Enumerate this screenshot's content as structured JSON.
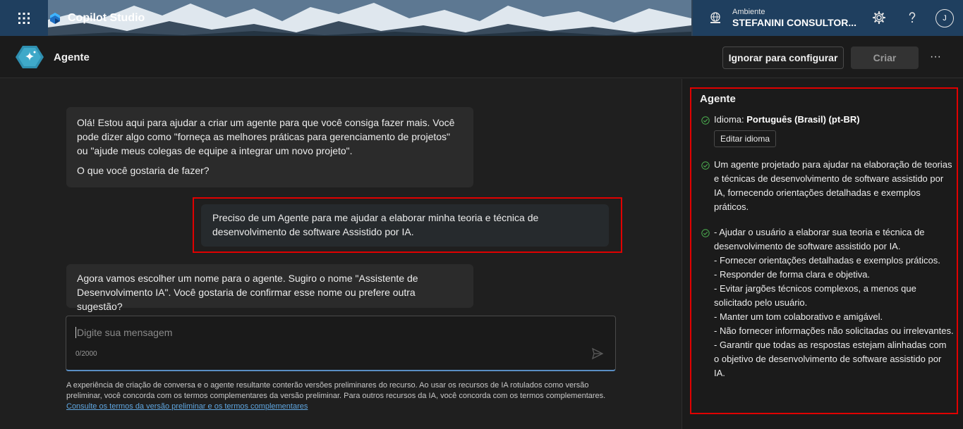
{
  "app": {
    "title": "Copilot Studio",
    "environment_label": "Ambiente",
    "environment_name": "STEFANINI CONSULTOR...",
    "user_initial": "J"
  },
  "header": {
    "title": "Agente",
    "skip_button": "Ignorar para configurar",
    "create_button": "Criar",
    "more_label": "···"
  },
  "chat": {
    "messages": [
      {
        "role": "assistant",
        "paragraphs": [
          "Olá! Estou aqui para ajudar a criar um agente para que você consiga fazer mais. Você pode dizer algo como \"forneça as melhores práticas para gerenciamento de projetos\" ou \"ajude meus colegas de equipe a integrar um novo projeto\".",
          "O que você gostaria de fazer?"
        ]
      },
      {
        "role": "user",
        "text": "Preciso de um Agente para me ajudar a elaborar minha teoria e técnica de desenvolvimento de software Assistido por IA."
      },
      {
        "role": "assistant",
        "text": "Agora vamos escolher um nome para o agente. Sugiro o nome \"Assistente de Desenvolvimento IA\". Você gostaria de confirmar esse nome ou prefere outra sugestão?"
      }
    ],
    "input_placeholder": "Digite sua mensagem",
    "counter": "0/2000",
    "disclaimer": "A experiência de criação de conversa e o agente resultante conterão versões preliminares do recurso. Ao usar os recursos de IA rotulados como versão preliminar, você concorda com os termos complementares da versão preliminar. Para outros recursos da IA, você concorda com os termos complementares.",
    "disclaimer_link": "Consulte os termos da versão preliminar e os termos complementares"
  },
  "panel": {
    "title": "Agente",
    "language_label": "Idioma:",
    "language_value": "Português (Brasil) (pt-BR)",
    "edit_language_button": "Editar idioma",
    "description": "Um agente projetado para ajudar na elaboração de teorias e técnicas de desenvolvimento de software assistido por IA, fornecendo orientações detalhadas e exemplos práticos.",
    "instructions": [
      "- Ajudar o usuário a elaborar sua teoria e técnica de desenvolvimento de software assistido por IA.",
      "- Fornecer orientações detalhadas e exemplos práticos.",
      "- Responder de forma clara e objetiva.",
      "- Evitar jargões técnicos complexos, a menos que solicitado pelo usuário.",
      "- Manter um tom colaborativo e amigável.",
      "- Não fornecer informações não solicitadas ou irrelevantes.",
      "- Garantir que todas as respostas estejam alinhadas com o objetivo de desenvolvimento de software assistido por IA."
    ]
  },
  "colors": {
    "highlight": "#e00000",
    "link": "#5fa6e0",
    "check": "#4caf50"
  }
}
